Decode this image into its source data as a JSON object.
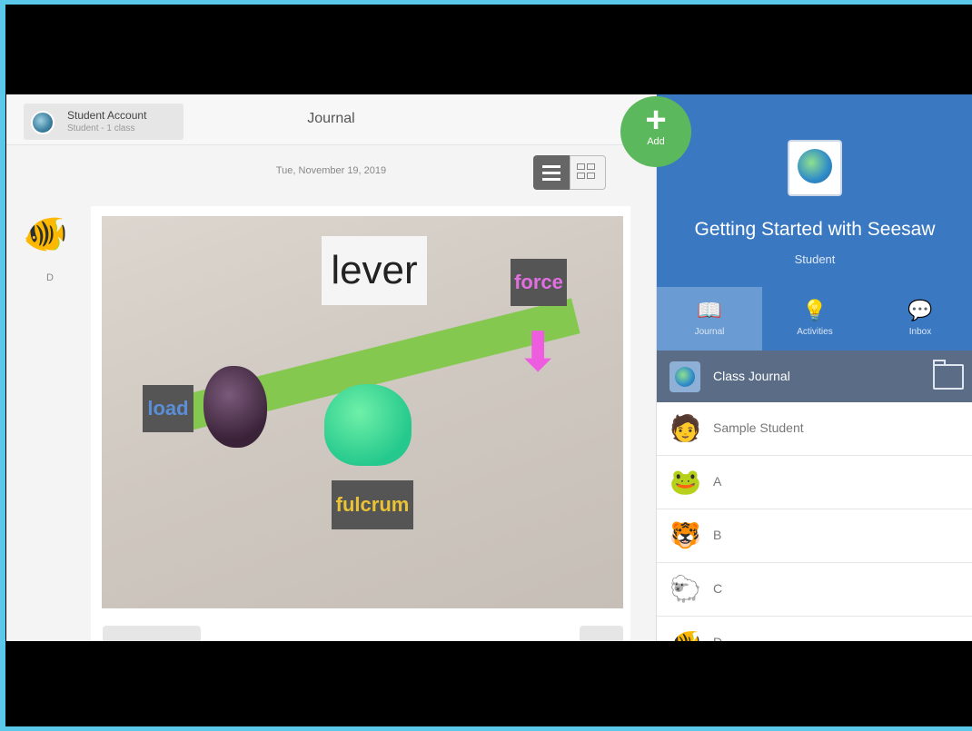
{
  "header": {
    "account_name": "Student Account",
    "account_sub": "Student - 1 class",
    "title": "Journal",
    "add_label": "Add",
    "add_glyph": "+"
  },
  "journal": {
    "date": "Tue, November 19, 2019",
    "post": {
      "author": "D",
      "author_emoji": "🐠",
      "stickers": {
        "lever": "lever",
        "force": "force",
        "load": "load",
        "fulcrum": "fulcrum"
      }
    }
  },
  "sidebar": {
    "class_name": "Getting Started with Seesaw",
    "class_role": "Student",
    "tabs": [
      {
        "label": "Journal",
        "icon": "📖"
      },
      {
        "label": "Activities",
        "icon": "💡"
      },
      {
        "label": "Inbox",
        "icon": "💬"
      }
    ],
    "class_journal_label": "Class Journal",
    "students": [
      {
        "name": "Sample Student",
        "emoji": "🧑"
      },
      {
        "name": "A",
        "emoji": "🐸"
      },
      {
        "name": "B",
        "emoji": "🐯"
      },
      {
        "name": "C",
        "emoji": "🐑"
      },
      {
        "name": "D",
        "emoji": "🐠"
      }
    ]
  },
  "colors": {
    "frame": "#5ac8e8",
    "add_button": "#5cb85c",
    "sidebar_header": "#3a78c2",
    "class_journal_row": "#5b6d86"
  }
}
